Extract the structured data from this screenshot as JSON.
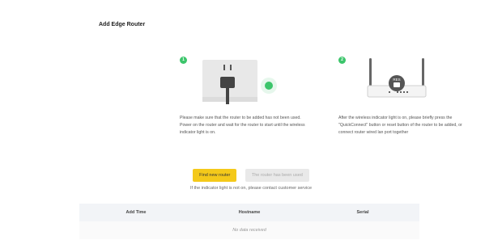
{
  "page": {
    "title": "Add Edge Router"
  },
  "steps": [
    {
      "number": "1",
      "text": "Please make sure that the router to be added has not been used. Power on the router and wait for the router to start until the wireless indicator light is on."
    },
    {
      "number": "2",
      "text": "After the wireless indicator light is on, please briefly press the \"QuickConnect\" button or reset button of the router to be added, or connect router wired lan port together"
    }
  ],
  "actions": {
    "find_label": "Find new router",
    "used_label": "The router has been used"
  },
  "hint": "If the indicator light is not on, please contact customer service",
  "table": {
    "columns": [
      "Add Time",
      "Hostname",
      "Serial"
    ],
    "empty_text": "No data received"
  },
  "colors": {
    "accent": "#3cc56b",
    "primary_button": "#f4c91a"
  },
  "illustration2_badge": "RES"
}
